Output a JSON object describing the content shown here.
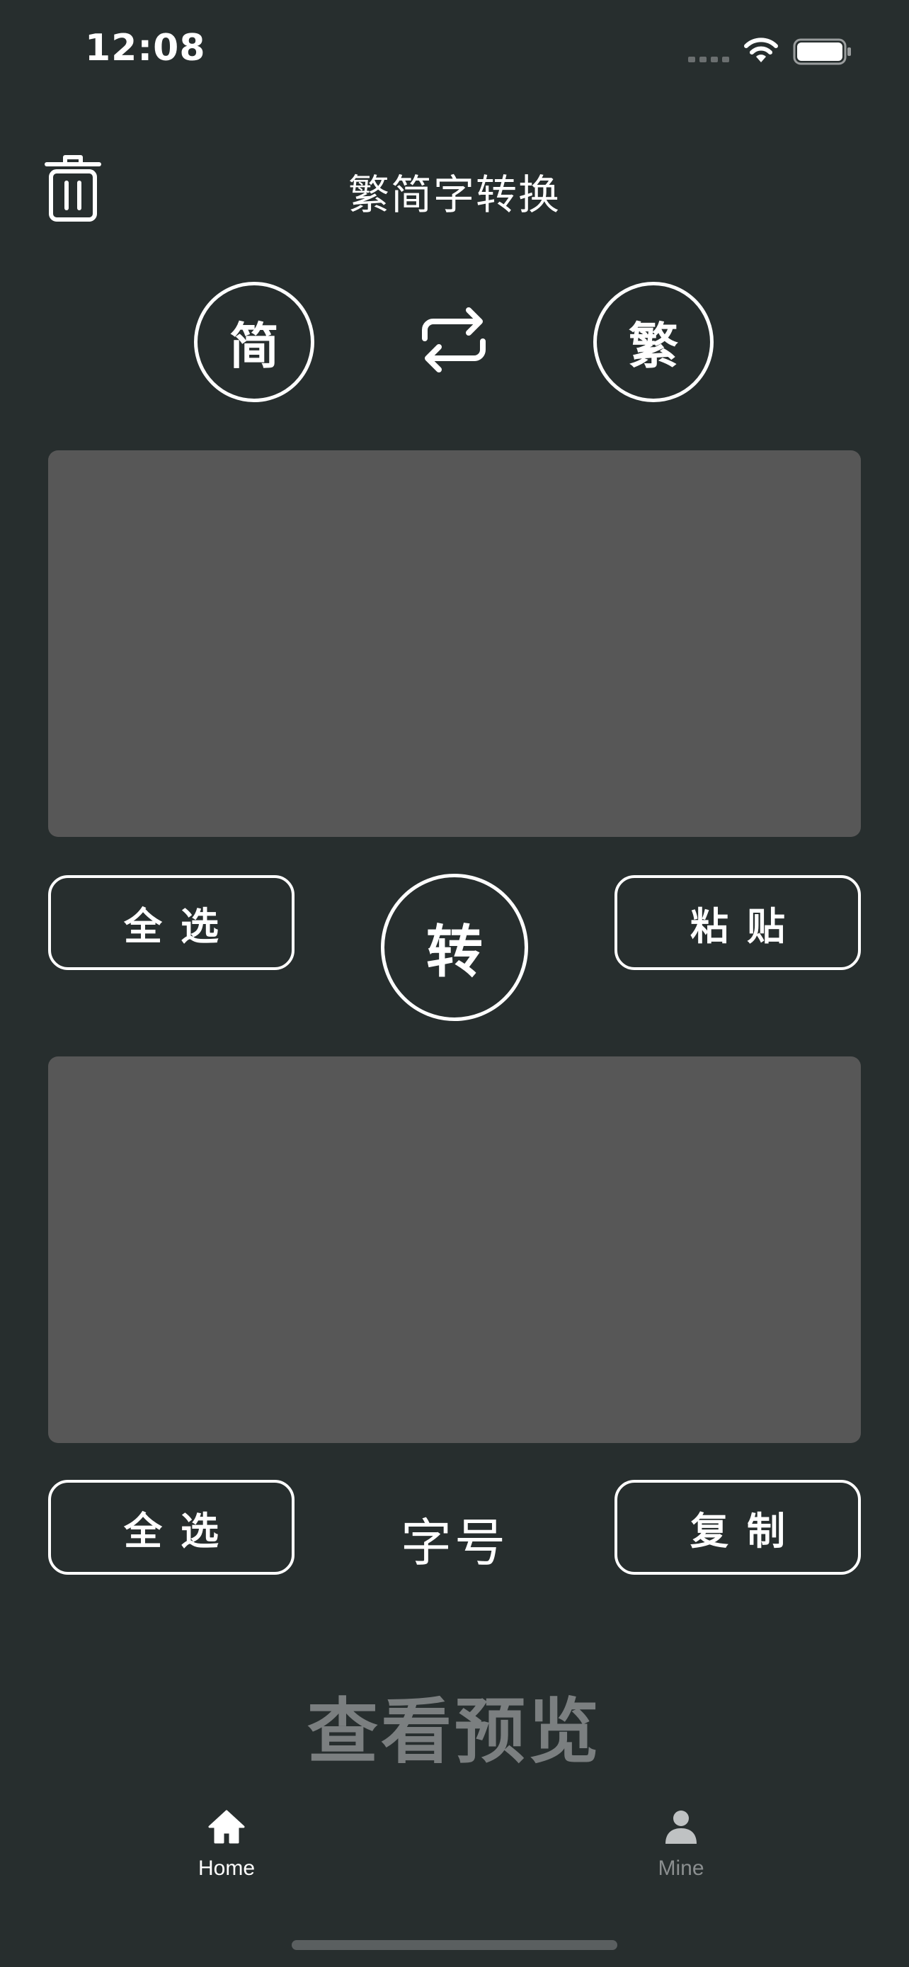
{
  "status_bar": {
    "time": "12:08"
  },
  "header": {
    "title": "繁简字转换"
  },
  "modes": {
    "simplified": "简",
    "traditional": "繁"
  },
  "input_area": {
    "value": "",
    "placeholder": ""
  },
  "input_actions": {
    "select_all": "全选",
    "convert": "转",
    "paste": "粘贴"
  },
  "output_area": {
    "value": "",
    "placeholder": ""
  },
  "output_actions": {
    "select_all": "全选",
    "font_size": "字号",
    "copy": "复制"
  },
  "preview": {
    "label": "查看预览"
  },
  "tab_bar": {
    "home": "Home",
    "mine": "Mine"
  },
  "colors": {
    "background": "#272e2e",
    "text_area": "#575757",
    "tab_active": "#ffffff",
    "tab_inactive": "#8a8e8f"
  }
}
